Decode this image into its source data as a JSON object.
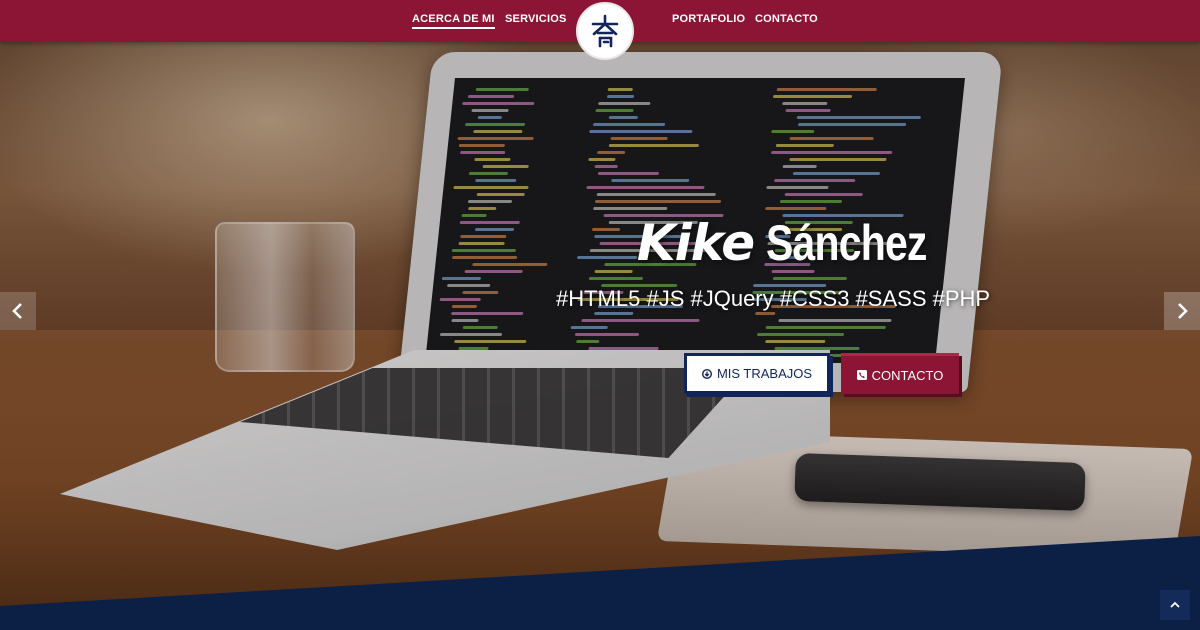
{
  "nav": {
    "items": [
      {
        "label": "ACERCA DE MI",
        "active": true
      },
      {
        "label": "SERVICIOS",
        "active": false
      },
      {
        "label": "PORTAFOLIO",
        "active": false
      },
      {
        "label": "CONTACTO",
        "active": false
      }
    ],
    "logo_icon": "kanji-logo-icon"
  },
  "hero": {
    "first_name": "Kike",
    "last_name": "Sánchez",
    "tags": "#HTML5 #JS #JQuery #CSS3 #SASS #PHP",
    "buttons": {
      "work_label": "MIS TRABAJOS",
      "work_icon": "arrow-circle-down-icon",
      "contact_label": "CONTACTO",
      "contact_icon": "phone-square-icon"
    }
  },
  "carousel": {
    "prev_icon": "chevron-left-icon",
    "next_icon": "chevron-right-icon"
  },
  "scroll_top_icon": "chevron-up-icon",
  "colors": {
    "navbar": "#8c1535",
    "navy": "#12255a",
    "footer_band": "#0c1f45",
    "text": "#ffffff"
  }
}
